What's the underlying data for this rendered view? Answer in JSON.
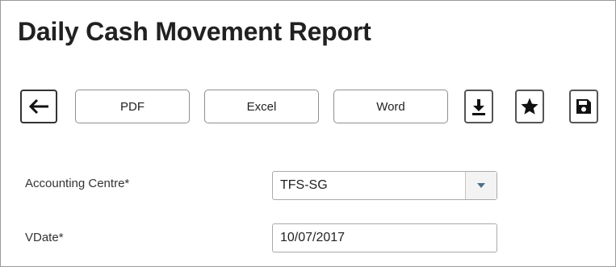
{
  "page": {
    "title": "Daily Cash Movement Report"
  },
  "toolbar": {
    "back_icon": "arrow-left-icon",
    "pdf_label": "PDF",
    "excel_label": "Excel",
    "word_label": "Word",
    "download_icon": "download-icon",
    "favorite_icon": "star-icon",
    "save_icon": "floppy-disk-icon"
  },
  "form": {
    "accounting_centre": {
      "label": "Accounting Centre*",
      "value": "TFS-SG",
      "dropdown_icon": "caret-down-icon",
      "dropdown_icon_color": "#4a6f8a"
    },
    "vdate": {
      "label": "VDate*",
      "value": "10/07/2017"
    }
  },
  "colors": {
    "title": "#212121",
    "border": "#8f8f8f",
    "text": "#333333"
  }
}
